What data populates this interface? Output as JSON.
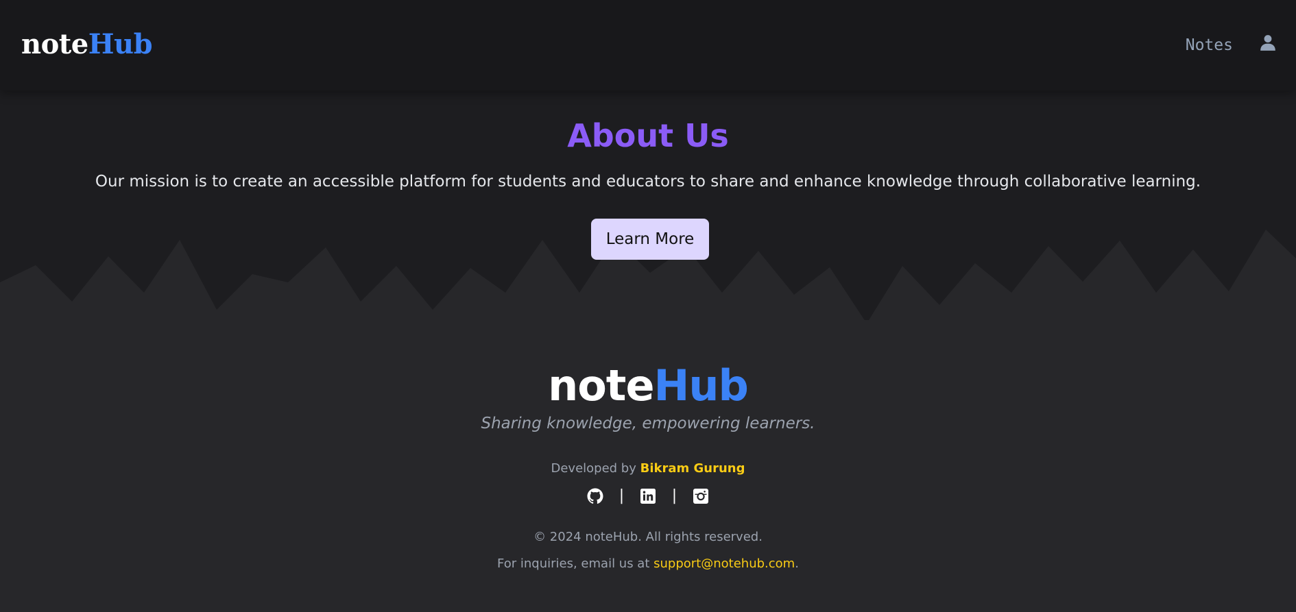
{
  "header": {
    "logo_part1": "note",
    "logo_part2": "Hub",
    "nav_notes": "Notes",
    "user_icon": "user-icon"
  },
  "hero": {
    "title": "About Us",
    "description": "Our mission is to create an accessible platform for students and educators to share and enhance knowledge through collaborative learning.",
    "button_label": "Learn More"
  },
  "footer": {
    "logo_part1": "note",
    "logo_part2": "Hub",
    "tagline": "Sharing knowledge, empowering learners.",
    "developed_by": "Developed by",
    "developer_name": "Bikram Gurung",
    "social_icons": [
      "github-icon",
      "linkedin-icon",
      "instagram-icon"
    ],
    "separator": "|",
    "copyright": "© 2024 noteHub. All rights reserved.",
    "inquiry_prefix": "For inquiries, email us at",
    "email": "support@notehub.com",
    "inquiry_suffix": "."
  },
  "colors": {
    "background": "#1d1d20",
    "header": "#18181b",
    "footer": "#27272a",
    "mountains": "#27272a",
    "brand_blue": "#3b82f6",
    "title_purple": "#8b5cf6",
    "button_bg": "#ddd6fe",
    "accent_yellow": "#facc15",
    "muted_text": "#9ca3af"
  }
}
